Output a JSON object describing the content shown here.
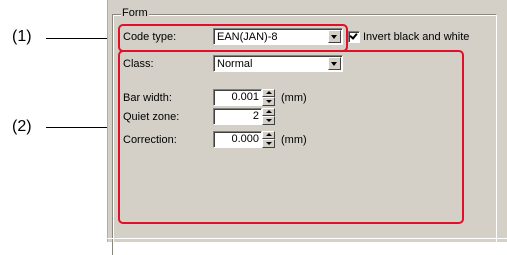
{
  "callouts": {
    "c1": "(1)",
    "c2": "(2)",
    "color": "#e0102a"
  },
  "form": {
    "group_title": "Form",
    "code_type": {
      "label": "Code type:",
      "value": "EAN(JAN)-8"
    },
    "invert": {
      "label": "Invert black and white",
      "checked": true
    },
    "class": {
      "label": "Class:",
      "value": "Normal"
    },
    "bar_width": {
      "label": "Bar width:",
      "value": "0.001",
      "unit": "(mm)"
    },
    "quiet_zone": {
      "label": "Quiet zone:",
      "value": "2"
    },
    "correction": {
      "label": "Correction:",
      "value": "0.000",
      "unit": "(mm)"
    }
  }
}
